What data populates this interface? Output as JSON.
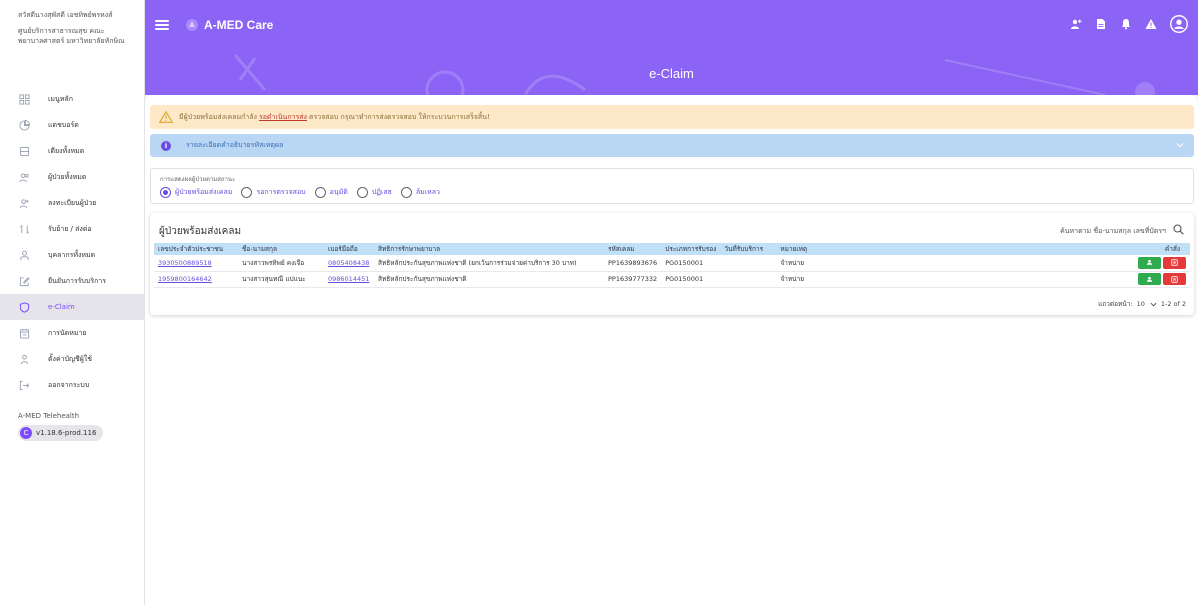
{
  "sidebar": {
    "org_line1": "สวัสดีนางสุพัสดี เอชทิพย์พรหงส์",
    "org_line2": "ศูนย์บริการสาธารณสุข คณะ",
    "org_line3": "พยาบาลศาสตร์ มหาวิทยาลัยทักษิณ",
    "items": [
      {
        "label": "เมนูหลัก",
        "icon": "grid-icon"
      },
      {
        "label": "แดชบอร์ด",
        "icon": "pie-chart-icon"
      },
      {
        "label": "เตียงทั้งหมด",
        "icon": "bed-icon"
      },
      {
        "label": "ผู้ป่วยทั้งหมด",
        "icon": "users-icon"
      },
      {
        "label": "ลงทะเบียนผู้ป่วย",
        "icon": "user-plus-icon"
      },
      {
        "label": "รับย้าย / ส่งต่อ",
        "icon": "transfer-icon"
      },
      {
        "label": "บุคลากรทั้งหมด",
        "icon": "staff-icon"
      },
      {
        "label": "ยืนยันการรับบริการ",
        "icon": "edit-icon"
      },
      {
        "label": "e-Claim",
        "icon": "shield-icon",
        "active": true
      },
      {
        "label": "การนัดหมาย",
        "icon": "calendar-icon"
      },
      {
        "label": "ตั้งค่าบัญชีผู้ใช้",
        "icon": "user-icon"
      },
      {
        "label": "ออกจากระบบ",
        "icon": "logout-icon"
      }
    ],
    "footer_app": "A-MED Telehealth",
    "version": "v1.18.6-prod.116",
    "version_letter": "C"
  },
  "header": {
    "app_title": "A-MED Care",
    "page_title": "e-Claim",
    "icons": [
      "user-add-icon",
      "document-icon",
      "bell-icon",
      "warning-icon",
      "avatar-icon"
    ]
  },
  "colors": {
    "primary": "#8b63f5",
    "accent": "#6a4ce0",
    "warn_bg": "#fde8c8",
    "info_bg": "#b9d7f5",
    "table_header": "#bfe0f7",
    "button_green": "#2faa4f",
    "button_red": "#e43a3a"
  },
  "warning": {
    "text_before": "มีผู้ป่วยพร้อมส่งเคลมกำลัง",
    "link": "รอดำเนินการส่ง",
    "text_after": "ตรวจสอบ กรุณาทำการส่งตรวจสอบ ให้กระบวนการเสร็จสิ้น!"
  },
  "info": {
    "text": "รายละเอียดคำอธิบายรหัสเหตุผล"
  },
  "filter": {
    "label": "การแสดงผลผู้ป่วยตามสถานะ",
    "options": [
      {
        "label": "ผู้ป่วยพร้อมส่งเคลม",
        "checked": true
      },
      {
        "label": "รอการตรวจสอบ",
        "checked": false
      },
      {
        "label": "อนุมัติ",
        "checked": false
      },
      {
        "label": "ปฏิเสธ",
        "checked": false
      },
      {
        "label": "ล้มเหลว",
        "checked": false
      }
    ]
  },
  "table": {
    "title": "ผู้ป่วยพร้อมส่งเคลม",
    "search_label": "ค้นหาตาม ชื่อ-นามสกุล เลขที่บัตรฯ",
    "columns": [
      "เลขประจำตัวประชาชน",
      "ชื่อ-นามสกุล",
      "เบอร์มือถือ",
      "สิทธิการรักษาพยาบาล",
      "รหัสเคลม",
      "ประเภทการรับรอง",
      "วันที่รับบริการ",
      "หมายเหตุ",
      "คำสั่ง"
    ],
    "rows": [
      {
        "id_no": "3930500889518",
        "name": "นางสาวพรทิพย์ คงเจือ",
        "phone": "0805408438",
        "right": "สิทธิหลักประกันสุขภาพแห่งชาติ (ยกเว้นการร่วมจ่ายค่าบริการ 30 บาท)",
        "claim_code": "PP1639893676",
        "cert_type": "PG0150001",
        "service_date": "",
        "note": "จำหน่าย"
      },
      {
        "id_no": "1959800164642",
        "name": "นางสาวสุนทณี แปแนะ",
        "phone": "0986014451",
        "right": "สิทธิหลักประกันสุขภาพแห่งชาติ",
        "claim_code": "PP1639777332",
        "cert_type": "PG0150001",
        "service_date": "",
        "note": "จำหน่าย"
      }
    ],
    "pagination": {
      "rows_label": "แถวต่อหน้า:",
      "rows_per_page": "10",
      "range": "1-2 of 2"
    }
  }
}
